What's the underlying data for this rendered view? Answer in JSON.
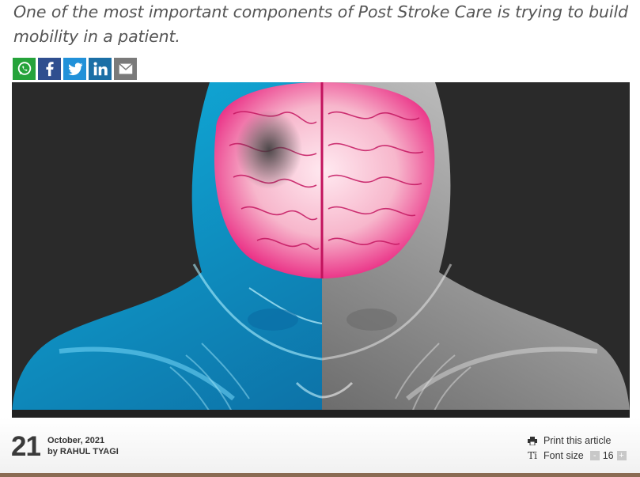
{
  "article": {
    "subtitle": "One of the most important components of Post Stroke Care is trying to build mobility in a patient."
  },
  "share": [
    {
      "name": "whatsapp",
      "icon": "whatsapp-icon",
      "color": "#25a33a"
    },
    {
      "name": "facebook",
      "icon": "facebook-icon",
      "color": "#2f4f8f"
    },
    {
      "name": "twitter",
      "icon": "twitter-icon",
      "color": "#2191d9"
    },
    {
      "name": "linkedin",
      "icon": "linkedin-icon",
      "color": "#1b6fa6"
    },
    {
      "name": "email",
      "icon": "email-icon",
      "color": "#7a7a7a"
    }
  ],
  "meta": {
    "day": "21",
    "month_year": "October, 2021",
    "by_label": "by",
    "author": "RAHUL TYAGI"
  },
  "tools": {
    "print_label": "Print this article",
    "font_size_label": "Font size",
    "font_size_value": "16",
    "decrease_symbol": "-",
    "increase_symbol": "+"
  }
}
